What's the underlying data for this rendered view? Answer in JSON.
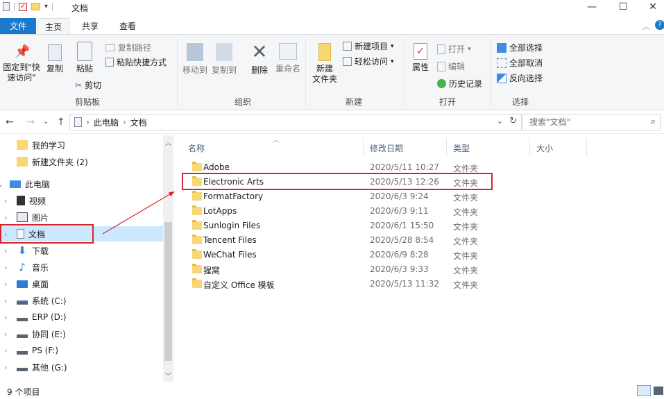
{
  "window": {
    "title": "文档",
    "controls": [
      "—",
      "☐",
      "✕"
    ]
  },
  "ribbon_tabs": [
    {
      "label": "文件"
    },
    {
      "label": "主页"
    },
    {
      "label": "共享"
    },
    {
      "label": "查看"
    }
  ],
  "clipboard": {
    "pin_label": "固定到\"快\n速访问\"",
    "copy_label": "复制",
    "paste_label": "粘贴",
    "copy_path_label": "复制路径",
    "paste_shortcut_label": "粘贴快捷方式",
    "cut_label": "剪切",
    "group_label": "剪贴板"
  },
  "organize": {
    "move_to_label": "移动到",
    "copy_to_label": "复制到",
    "delete_label": "删除",
    "rename_label": "重命名",
    "group_label": "组织"
  },
  "new_group": {
    "new_folder_label": "新建\n文件夹",
    "new_item_label": "新建项目",
    "easy_access_label": "轻松访问",
    "group_label": "新建"
  },
  "open_group": {
    "properties_label": "属性",
    "open_label": "打开",
    "edit_label": "编辑",
    "history_label": "历史记录",
    "group_label": "打开"
  },
  "select_group": {
    "select_all_label": "全部选择",
    "select_none_label": "全部取消",
    "invert_label": "反向选择",
    "group_label": "选择"
  },
  "address": {
    "path": [
      "此电脑",
      "文档"
    ],
    "search_placeholder": "搜索\"文档\""
  },
  "nav_pane": {
    "items": [
      {
        "label": "我的学习",
        "icon": "folder-icon"
      },
      {
        "label": "新建文件夹 (2)",
        "icon": "folder-icon"
      },
      {
        "label": "此电脑",
        "icon": "pc-icon"
      },
      {
        "label": "视频",
        "icon": "video-icon"
      },
      {
        "label": "图片",
        "icon": "picture-icon"
      },
      {
        "label": "文档",
        "icon": "document-icon"
      },
      {
        "label": "下载",
        "icon": "download-icon"
      },
      {
        "label": "音乐",
        "icon": "music-icon"
      },
      {
        "label": "桌面",
        "icon": "desktop-icon"
      },
      {
        "label": "系统 (C:)",
        "icon": "drive-icon"
      },
      {
        "label": "ERP (D:)",
        "icon": "drive-icon"
      },
      {
        "label": "协同 (E:)",
        "icon": "drive-icon"
      },
      {
        "label": "PS (F:)",
        "icon": "drive-icon"
      },
      {
        "label": "其他 (G:)",
        "icon": "drive-icon"
      }
    ]
  },
  "file_list": {
    "columns": [
      "名称",
      "修改日期",
      "类型",
      "大小"
    ],
    "rows": [
      {
        "name": "Adobe",
        "date": "2020/5/11 10:27",
        "type": "文件夹"
      },
      {
        "name": "Electronic Arts",
        "date": "2020/5/13 12:26",
        "type": "文件夹"
      },
      {
        "name": "FormatFactory",
        "date": "2020/6/3 9:24",
        "type": "文件夹"
      },
      {
        "name": "LotApps",
        "date": "2020/6/3 9:11",
        "type": "文件夹"
      },
      {
        "name": "Sunlogin Files",
        "date": "2020/6/1 15:50",
        "type": "文件夹"
      },
      {
        "name": "Tencent Files",
        "date": "2020/5/28 8:54",
        "type": "文件夹"
      },
      {
        "name": "WeChat Files",
        "date": "2020/6/9 8:28",
        "type": "文件夹"
      },
      {
        "name": "猩窝",
        "date": "2020/6/3 9:33",
        "type": "文件夹"
      },
      {
        "name": "自定义 Office 模板",
        "date": "2020/5/13 11:32",
        "type": "文件夹"
      }
    ]
  },
  "status_bar": {
    "item_count": "9 个项目"
  },
  "colors": {
    "accent": "#1979ca",
    "selection": "#cce8ff",
    "annotation": "#d9232b",
    "folder": "#f8d775"
  }
}
